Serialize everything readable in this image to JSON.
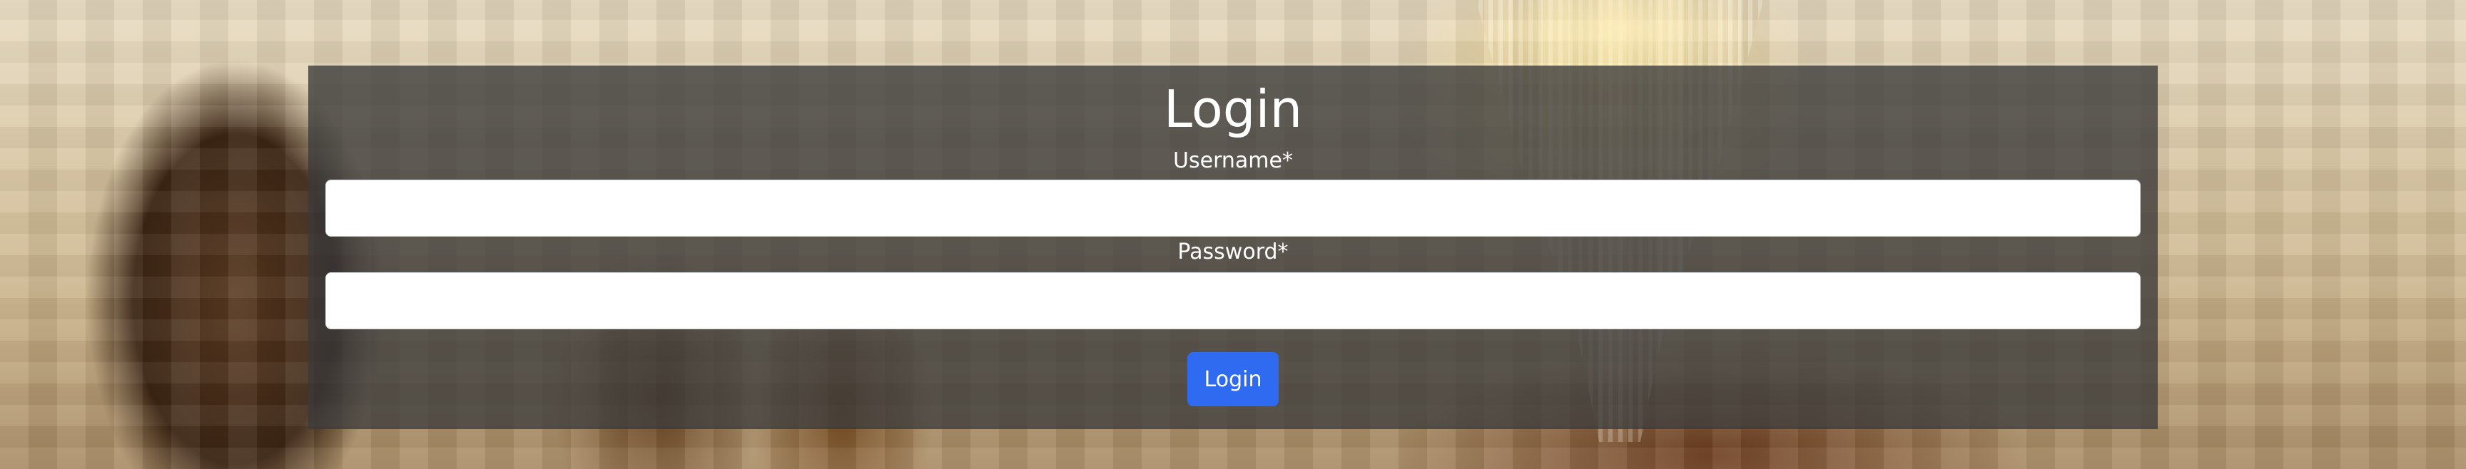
{
  "login_form": {
    "title": "Login",
    "username_label": "Username*",
    "username_value": "",
    "password_label": "Password*",
    "password_value": "",
    "submit_label": "Login"
  },
  "colors": {
    "panel_overlay": "#3a3a3a",
    "button_bg": "#2f6bf0",
    "text": "#ffffff"
  }
}
